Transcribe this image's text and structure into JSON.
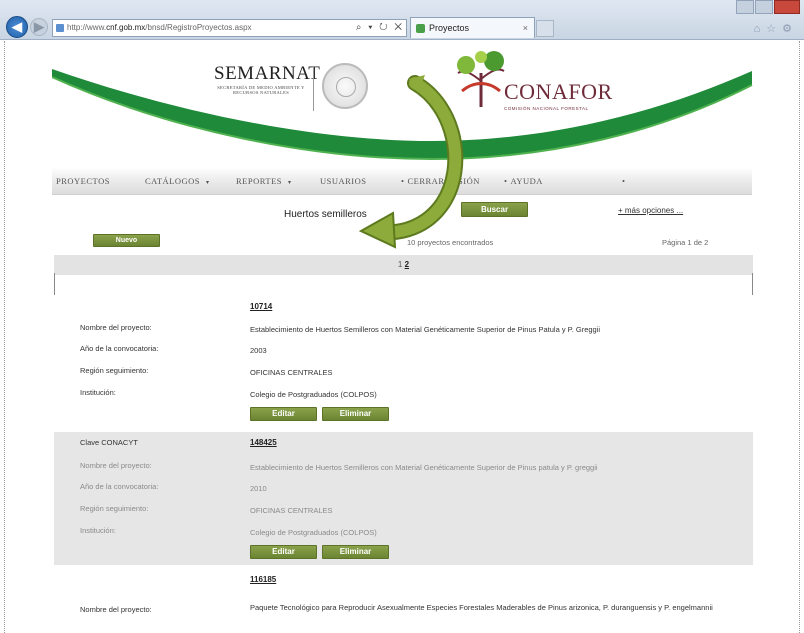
{
  "browser": {
    "url_prefix": "http://www.",
    "url_host": "cnf.gob.mx",
    "url_path": "/bnsd/RegistroProyectos.aspx",
    "address_controls": "⌕ ▾ ↻ ✕",
    "tab_title": "Proyectos",
    "tab_close": "×"
  },
  "header": {
    "semarnat": "SEMARNAT",
    "semarnat_sub": "SECRETARÍA DE MEDIO AMBIENTE Y RECURSOS NATURALES",
    "conafor": "CONAFOR",
    "conafor_sub": "COMISIÓN NACIONAL FORESTAL"
  },
  "menu": [
    {
      "label": "PROYECTOS",
      "prefix": "",
      "caret": ""
    },
    {
      "label": "CATÁLOGOS",
      "prefix": "",
      "caret": "▾"
    },
    {
      "label": "REPORTES",
      "prefix": "",
      "caret": "▾"
    },
    {
      "label": "USUARIOS",
      "prefix": "",
      "caret": ""
    },
    {
      "label": "CERRAR SESIÓN",
      "prefix": "•",
      "caret": ""
    },
    {
      "label": "AYUDA",
      "prefix": "•",
      "caret": ""
    },
    {
      "label": "",
      "prefix": "•",
      "caret": ""
    }
  ],
  "search": {
    "value": "Huertos semilleros",
    "button": "Buscar",
    "more_options": "+ más opciones ..."
  },
  "list": {
    "new_button": "Nuevo",
    "found": "10 proyectos encontrados",
    "page_info": "Página 1 de 2",
    "pages": [
      "1",
      "2"
    ],
    "current_page": "2"
  },
  "labels": {
    "clave": "Clave CONACYT",
    "nombre": "Nombre del proyecto:",
    "anio": "Año de la convocatoria:",
    "region": "Región seguimiento:",
    "institucion": "Institución:",
    "edit": "Editar",
    "delete": "Eliminar"
  },
  "records": [
    {
      "id": "10714",
      "nombre": "Establecimiento de Huertos Semilleros con Material Genéticamente Superior de Pinus Patula y P. Greggii",
      "anio": "2003",
      "region": "OFICINAS CENTRALES",
      "institucion": "Colegio de Postgraduados (COLPOS)"
    },
    {
      "id": "148425",
      "nombre": "Establecimiento de Huertos Semilleros con Material Genéticamente Superior de Pinus patula y P. greggii",
      "anio": "2010",
      "region": "OFICINAS CENTRALES",
      "institucion": "Colegio de Postgraduados (COLPOS)"
    },
    {
      "id": "116185",
      "nombre": "Paquete Tecnológico para Reproducir Asexualmente Especies Forestales Maderables de Pinus arizonica, P. duranguensis y P. engelmannii"
    }
  ],
  "colors": {
    "accent_green": "#6b8432",
    "conafor_maroon": "#6f2b3a",
    "arrow": "#8cab3a"
  }
}
